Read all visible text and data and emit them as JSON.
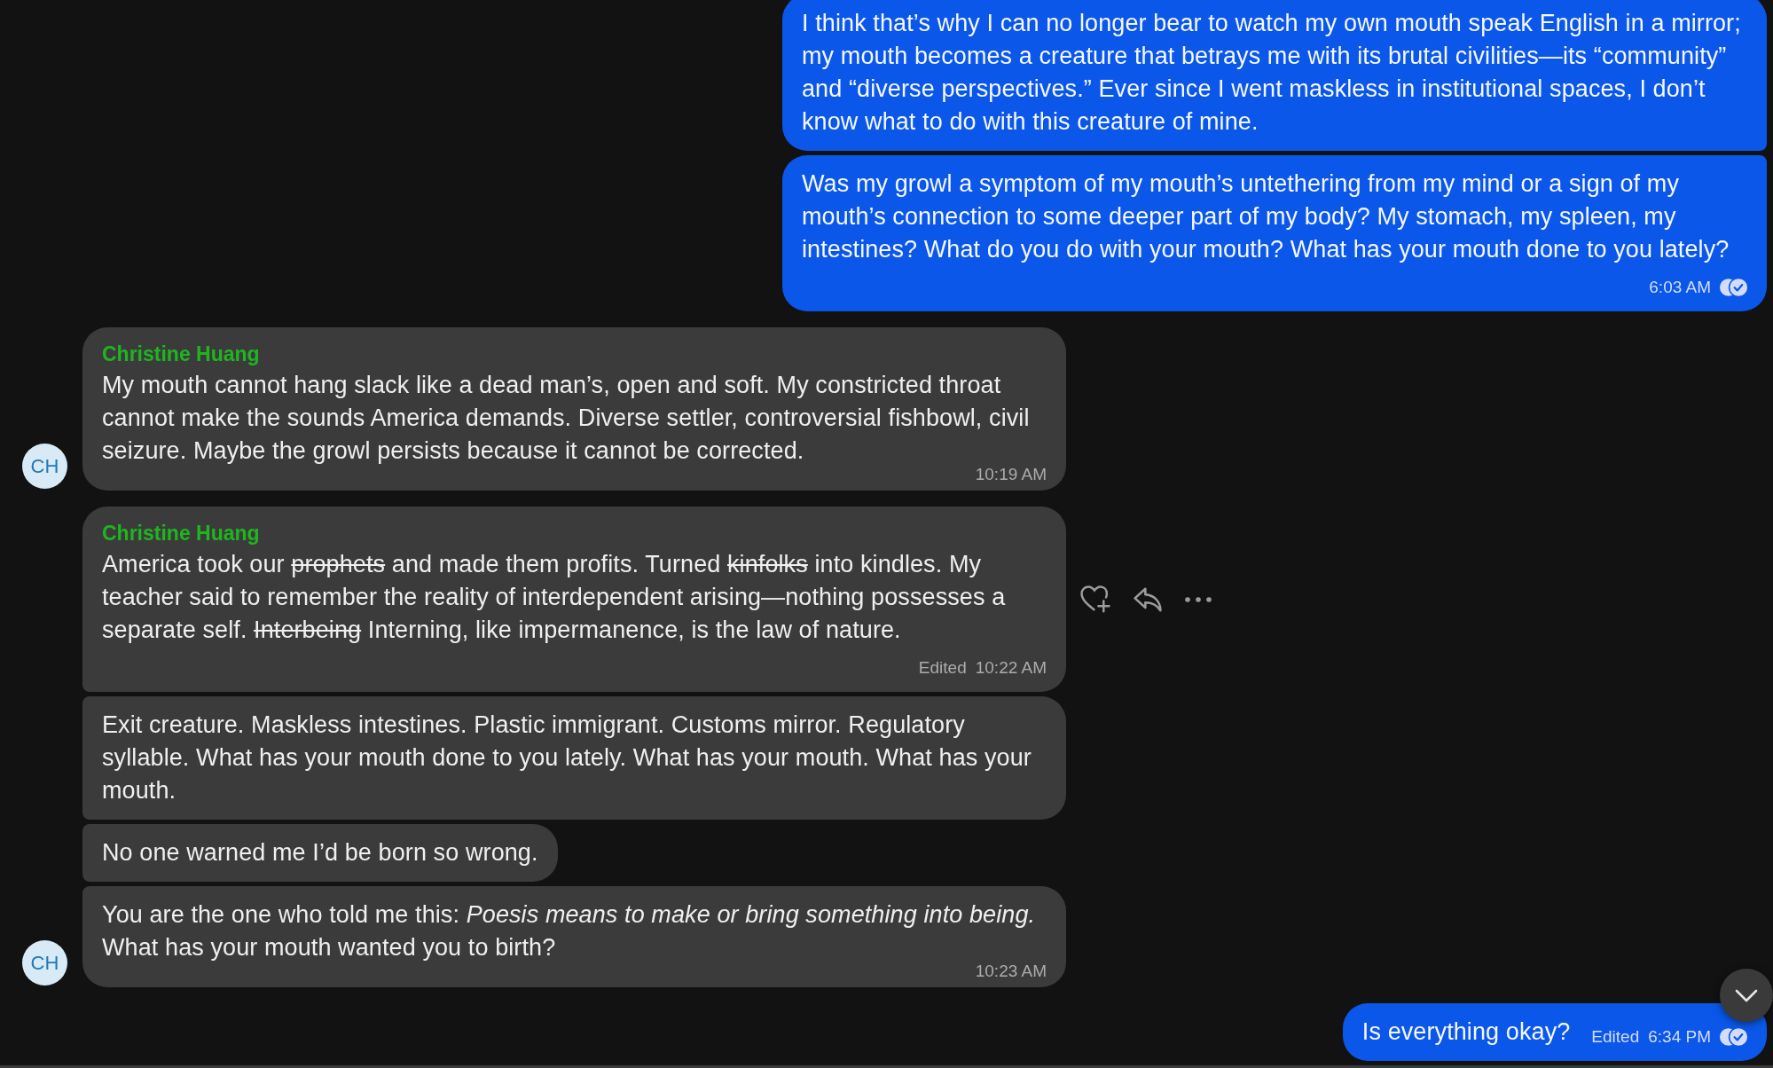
{
  "messages": [
    {
      "kind": "outgoing",
      "text": "I think that’s why I can no longer bear to watch my own mouth speak English in a mirror; my mouth becomes a creature that betrays me with its brutal civilities—its “community” and “diverse perspectives.” Ever since I went maskless in institutional spaces, I don’t know what to do with this creature of mine.",
      "hovered": false
    },
    {
      "kind": "outgoing",
      "text": "Was my growl a symptom of my mouth’s untethering from my mind or a sign of my mouth’s connection to some deeper part of my body? My stomach, my spleen, my intestines? What do you do with your mouth? What has your mouth done to you lately?",
      "time": "6:03 AM",
      "read": true,
      "hovered": false
    },
    {
      "kind": "incoming",
      "sender": "Christine Huang",
      "text": "My mouth cannot hang slack like a dead man’s, open and soft. My constricted throat cannot make the sounds America demands. Diverse settler, controversial fishbowl, civil seizure. Maybe the growl persists because it cannot be corrected.",
      "time": "10:19 AM",
      "avatar": "CH",
      "hovered": false
    },
    {
      "kind": "incoming",
      "sender": "Christine Huang",
      "segments": [
        {
          "text": "America took our ",
          "struck": false
        },
        {
          "text": "prophets",
          "struck": true
        },
        {
          "text": " and made them profits. Turned ",
          "struck": false
        },
        {
          "text": "kinfolks",
          "struck": true
        },
        {
          "text": " into kindles. My teacher said to remember the reality of interdependent arising—nothing possesses a separate self. ",
          "struck": false
        },
        {
          "text": "Interbeing",
          "struck": true
        },
        {
          "text": " Interning, like impermanence, is the law of nature.",
          "struck": false
        }
      ],
      "edited": "Edited",
      "time": "10:22 AM",
      "hovered": true
    },
    {
      "kind": "incoming",
      "text": "Exit creature. Maskless intestines. Plastic immigrant. Customs mirror. Regulatory syllable. What has your mouth done to you lately. What has your mouth. What has your mouth.",
      "hovered": false
    },
    {
      "kind": "incoming",
      "text": "No one warned me I’d be born so wrong.",
      "hovered": false
    },
    {
      "kind": "incoming",
      "text": "You are the one who told me this: *Poesis means to make or bring something into being.* What has your mouth wanted you to birth?",
      "time": "10:23 AM",
      "avatar": "CH",
      "hovered": false
    },
    {
      "kind": "outgoing",
      "text": "Is everything okay?",
      "edited": "Edited",
      "time": "6:34 PM",
      "read": true,
      "hovered": false
    }
  ]
}
